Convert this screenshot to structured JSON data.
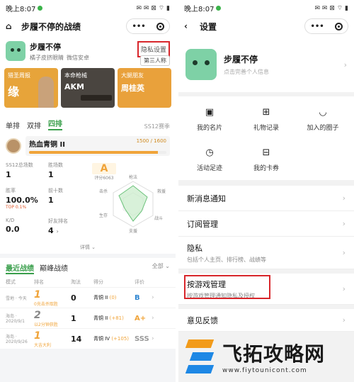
{
  "status": {
    "time": "晚上8:07",
    "icons": "✉ ✉ ⊠ ⌔ ▮"
  },
  "left": {
    "title": "步履不停的战绩",
    "capsule_more": "•••",
    "profile": {
      "name": "步履不停",
      "sub1": "橘子皮挤眼睛",
      "sub2": "微信安卓",
      "privacy_btn": "隐私设置",
      "view_btn": "第三人称"
    },
    "banners": [
      {
        "top": "猎圣周报",
        "main": "缘"
      },
      {
        "top": "本命枪械",
        "main": "AKM"
      },
      {
        "top": "大腿朋友",
        "main": "周桂英"
      }
    ],
    "mode_tabs": [
      "单排",
      "双排",
      "四排"
    ],
    "season": "SS12赛季",
    "rank": {
      "name": "热血青铜 II",
      "score": "1500 / 1600",
      "progress": 0.94
    },
    "stats": [
      {
        "label": "SS12总场数",
        "value": "1",
        "sub": ""
      },
      {
        "label": "胜场数",
        "value": "1",
        "sub": ""
      },
      {
        "label": "胜率",
        "value": "100.0%",
        "sub": "TOP 0.1%"
      },
      {
        "label": "前十数",
        "value": "1",
        "sub": ""
      },
      {
        "label": "K/D",
        "value": "0.0",
        "sub": ""
      },
      {
        "label": "好友排名",
        "value": "4",
        "sub": ""
      }
    ],
    "grade": {
      "letter": "A",
      "score": "评分6063"
    },
    "radar_labels": [
      "枪法",
      "救援",
      "战斗",
      "支援",
      "生存",
      "击杀"
    ],
    "detail": "详情 ⌄",
    "records_tabs": [
      "最近战绩",
      "巅峰战绩"
    ],
    "records_filter": "全部 ⌄",
    "columns": [
      "模式",
      "排名",
      "淘汰",
      "得分",
      "评价"
    ],
    "records": [
      {
        "mode": "雪地 · 今天",
        "rank": "1",
        "rank_text": "0充击杀取胜",
        "kills": "0",
        "tier": "青铜 II",
        "delta": "(0)",
        "grade": "B",
        "grade_color": "#2f86d1"
      },
      {
        "mode": "海岛 · 2020/9/1",
        "rank": "2",
        "rank_text": "以2分钟获胜",
        "kills": "1",
        "tier": "青铜 II",
        "delta": "(+81)",
        "grade": "A+",
        "grade_color": "#f0a43a"
      },
      {
        "mode": "海岛 · 2020/9/26",
        "rank": "1",
        "rank_text": "大吉大利",
        "kills": "14",
        "tier": "青铜 IV",
        "delta": "(+105)",
        "grade": "SSS",
        "grade_color": "#999999"
      }
    ]
  },
  "right": {
    "title": "设置",
    "profile": {
      "name": "步履不停",
      "hint": "点击完善个人信息"
    },
    "menu": [
      {
        "icon": "id-card-icon",
        "glyph": "▣",
        "label": "我的名片"
      },
      {
        "icon": "gift-icon",
        "glyph": "⊞",
        "label": "礼物记录"
      },
      {
        "icon": "chat-icon",
        "glyph": "◡",
        "label": "加入的圈子"
      },
      {
        "icon": "clock-icon",
        "glyph": "◷",
        "label": "活动足迹"
      },
      {
        "icon": "ticket-icon",
        "glyph": "⊟",
        "label": "我的卡券"
      }
    ],
    "list": [
      {
        "title": "新消息通知",
        "sub": ""
      },
      {
        "title": "订阅管理",
        "sub": ""
      },
      {
        "title": "隐私",
        "sub": "包括个人主页、排行榜、战绩等"
      },
      {
        "title": "按游戏管理",
        "sub": "按游戏管理通知隐私及授权"
      },
      {
        "title": "意见反馈",
        "sub": ""
      }
    ]
  },
  "watermark": {
    "cn": "飞拓攻略网",
    "url": "www.fiytounicont.com"
  },
  "colors": {
    "accent_green": "#3a9f4c",
    "highlight_red": "#d8262b",
    "orange": "#f0a43a"
  }
}
